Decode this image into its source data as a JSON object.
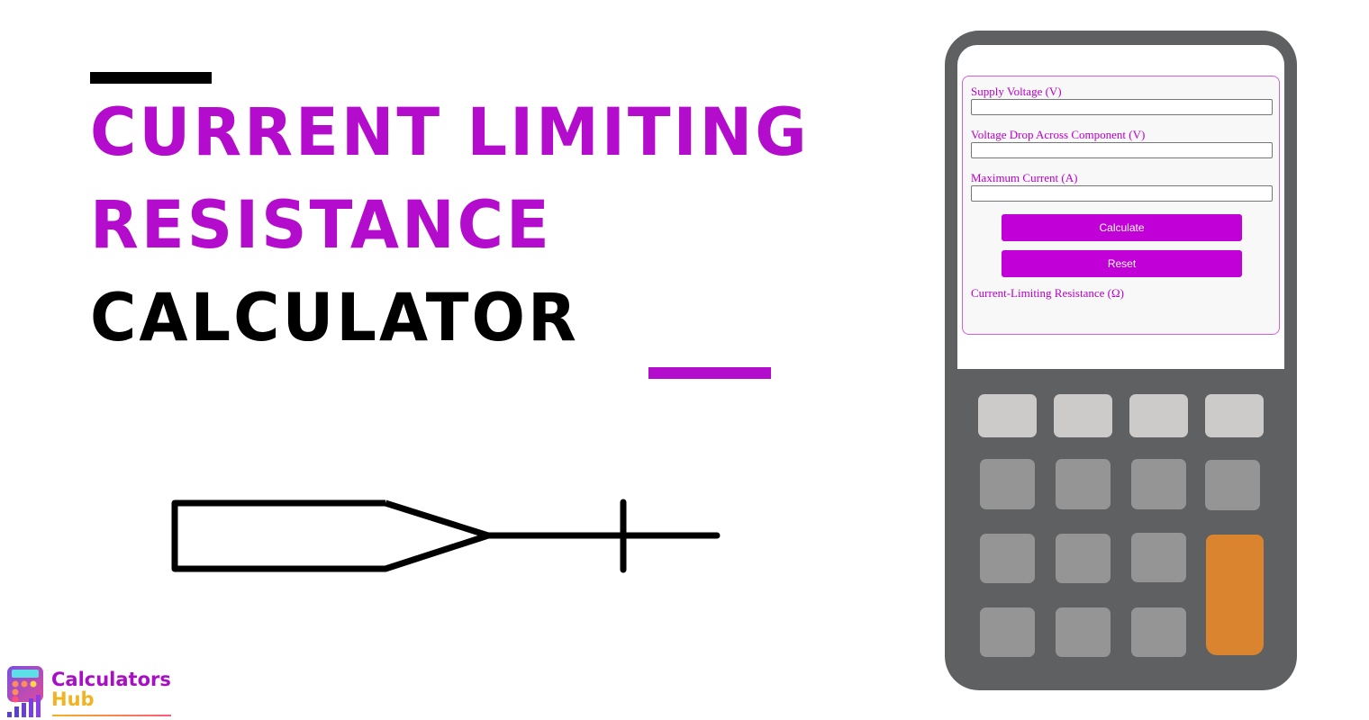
{
  "heading": {
    "line1": "Current Limiting",
    "line2": "Resistance",
    "line3": "Calculator",
    "accent_color": "#b40ccc",
    "text_color": "#000000"
  },
  "illustration": {
    "name": "resistor-symbol"
  },
  "calculator": {
    "fields": [
      {
        "label": "Supply Voltage (V)",
        "value": "",
        "placeholder": ""
      },
      {
        "label": "Voltage Drop Across Component (V)",
        "value": "",
        "placeholder": ""
      },
      {
        "label": "Maximum Current (A)",
        "value": "",
        "placeholder": ""
      }
    ],
    "calculate_label": "Calculate",
    "reset_label": "Reset",
    "result_label": "Current-Limiting Resistance (Ω)",
    "result_value": "",
    "button_color": "#c000d6",
    "label_color": "#b800c9"
  },
  "keypad": {
    "rows": [
      [
        "light",
        "light",
        "light",
        "light"
      ],
      [
        "mid",
        "mid",
        "mid",
        "mid"
      ],
      [
        "mid",
        "mid",
        "mid",
        "orange"
      ],
      [
        "mid",
        "mid",
        "mid"
      ]
    ],
    "colors": {
      "body": "#5f6062",
      "light": "#cccbc9",
      "mid": "#959595",
      "orange": "#da8430"
    }
  },
  "logo": {
    "word1": "Calculators",
    "word2": "Hub",
    "word1_color": "#a80fc5",
    "word2_color": "#f2b322"
  }
}
